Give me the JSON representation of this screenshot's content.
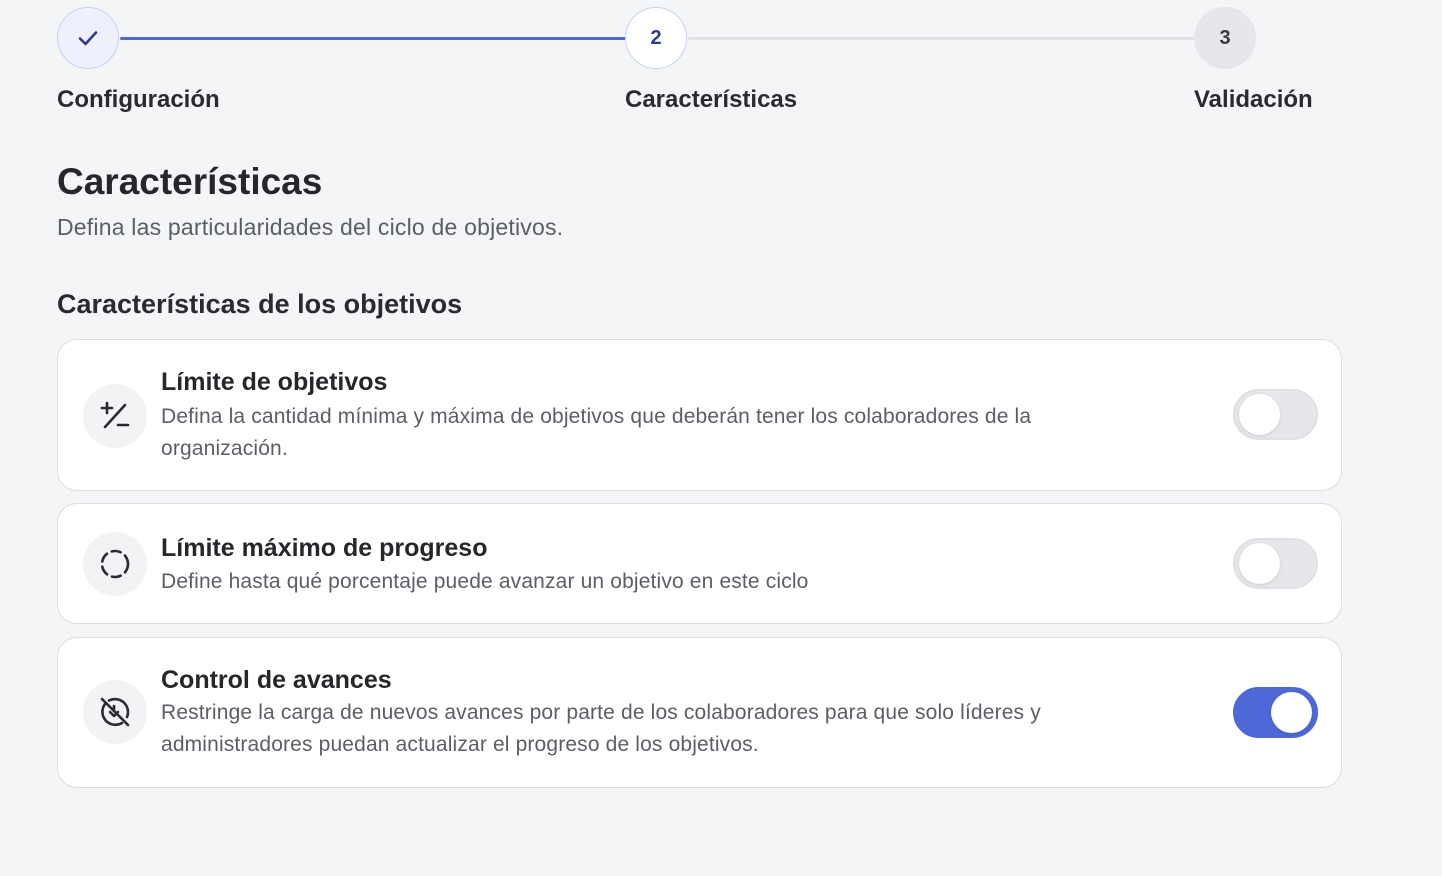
{
  "stepper": {
    "steps": [
      {
        "label": "Configuración",
        "number": "",
        "state": "completed"
      },
      {
        "label": "Características",
        "number": "2",
        "state": "current"
      },
      {
        "label": "Validación",
        "number": "3",
        "state": "upcoming"
      }
    ]
  },
  "page": {
    "title": "Características",
    "subtitle": "Defina las particularidades del ciclo de objetivos."
  },
  "section": {
    "title": "Características de los objetivos"
  },
  "features": [
    {
      "title": "Límite de objetivos",
      "description": "Defina la cantidad mínima y máxima de objetivos que deberán tener los colaboradores de la organización.",
      "icon": "plus-slash-minus-icon",
      "enabled": false
    },
    {
      "title": "Límite máximo de progreso",
      "description": "Define hasta qué porcentaje puede avanzar un objetivo en este ciclo",
      "icon": "dashed-circle-icon",
      "enabled": false
    },
    {
      "title": "Control de avances",
      "description": "Restringe la carga de nuevos avances por parte de los colaboradores para que solo líderes y administradores puedan actualizar el progreso de los objetivos.",
      "icon": "progress-off-icon",
      "enabled": true
    }
  ],
  "colors": {
    "accent": "#4f68d7",
    "background": "#f4f5f7",
    "toggle_off": "#e6e7eb"
  }
}
